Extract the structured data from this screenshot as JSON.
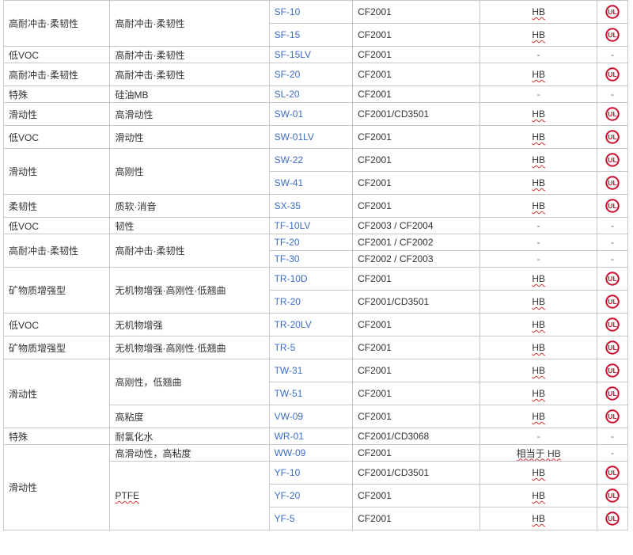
{
  "table": {
    "rows": [
      {
        "category": "高耐冲击·柔韧性",
        "feature": "高耐冲击·柔韧性",
        "grade": "SF-10",
        "standard": "CF2001",
        "rating": "HB",
        "ul_listed": true
      },
      {
        "category": "",
        "feature": "",
        "grade": "SF-15",
        "standard": "CF2001",
        "rating": "HB",
        "ul_listed": true
      },
      {
        "category": "低VOC",
        "feature": "高耐冲击·柔韧性",
        "grade": "SF-15LV",
        "standard": "CF2001",
        "rating": "-",
        "ul_listed": false
      },
      {
        "category": "高耐冲击·柔韧性",
        "feature": "高耐冲击·柔韧性",
        "grade": "SF-20",
        "standard": "CF2001",
        "rating": "HB",
        "ul_listed": true
      },
      {
        "category": "特殊",
        "feature": "硅油MB",
        "grade": "SL-20",
        "standard": "CF2001",
        "rating": "-",
        "ul_listed": false
      },
      {
        "category": "滑动性",
        "feature": "高滑动性",
        "grade": "SW-01",
        "standard": "CF2001/CD3501",
        "rating": "HB",
        "ul_listed": true
      },
      {
        "category": "低VOC",
        "feature": "滑动性",
        "grade": "SW-01LV",
        "standard": "CF2001",
        "rating": "HB",
        "ul_listed": true
      },
      {
        "category": "滑动性",
        "feature": "高刚性",
        "grade": "SW-22",
        "standard": "CF2001",
        "rating": "HB",
        "ul_listed": true
      },
      {
        "category": "",
        "feature": "",
        "grade": "SW-41",
        "standard": "CF2001",
        "rating": "HB",
        "ul_listed": true
      },
      {
        "category": "柔韧性",
        "feature": "质软·消音",
        "grade": "SX-35",
        "standard": "CF2001",
        "rating": "HB",
        "ul_listed": true
      },
      {
        "category": "低VOC",
        "feature": "韧性",
        "grade": "TF-10LV",
        "standard": "CF2003 / CF2004",
        "rating": "-",
        "ul_listed": false
      },
      {
        "category": "高耐冲击·柔韧性",
        "feature": "高耐冲击·柔韧性",
        "grade": "TF-20",
        "standard": "CF2001 / CF2002",
        "rating": "-",
        "ul_listed": false
      },
      {
        "category": "",
        "feature": "",
        "grade": "TF-30",
        "standard": "CF2002 / CF2003",
        "rating": "-",
        "ul_listed": false
      },
      {
        "category": "矿物质增强型",
        "feature": "无机物增强·高刚性·低翘曲",
        "grade": "TR-10D",
        "standard": "CF2001",
        "rating": "HB",
        "ul_listed": true
      },
      {
        "category": "",
        "feature": "",
        "grade": "TR-20",
        "standard": "CF2001/CD3501",
        "rating": "HB",
        "ul_listed": true
      },
      {
        "category": "低VOC",
        "feature": "无机物增强",
        "grade": "TR-20LV",
        "standard": "CF2001",
        "rating": "HB",
        "ul_listed": true
      },
      {
        "category": "矿物质增强型",
        "feature": "无机物增强·高刚性·低翘曲",
        "grade": "TR-5",
        "standard": "CF2001",
        "rating": "HB",
        "ul_listed": true
      },
      {
        "category": "滑动性",
        "feature": "高刚性，低翘曲",
        "grade": "TW-31",
        "standard": "CF2001",
        "rating": "HB",
        "ul_listed": true
      },
      {
        "category": "",
        "feature": "",
        "grade": "TW-51",
        "standard": "CF2001",
        "rating": "HB",
        "ul_listed": true
      },
      {
        "category": "",
        "feature": "高粘度",
        "grade": "VW-09",
        "standard": "CF2001",
        "rating": "HB",
        "ul_listed": true
      },
      {
        "category": "特殊",
        "feature": "耐氯化水",
        "grade": "WR-01",
        "standard": "CF2001/CD3068",
        "rating": "-",
        "ul_listed": false
      },
      {
        "category": "滑动性",
        "feature": "高滑动性，高粘度",
        "grade": "WW-09",
        "standard": "CF2001",
        "rating": "相当于 HB",
        "ul_listed": false
      },
      {
        "category": "",
        "feature": "PTFE",
        "grade": "YF-10",
        "standard": "CF2001/CD3501",
        "rating": "HB",
        "ul_listed": true
      },
      {
        "category": "",
        "feature": "",
        "grade": "YF-20",
        "standard": "CF2001",
        "rating": "HB",
        "ul_listed": true
      },
      {
        "category": "",
        "feature": "",
        "grade": "YF-5",
        "standard": "CF2001",
        "rating": "HB",
        "ul_listed": true
      }
    ]
  },
  "ul_mark": {
    "label": "UL",
    "color": "#c8102e"
  }
}
